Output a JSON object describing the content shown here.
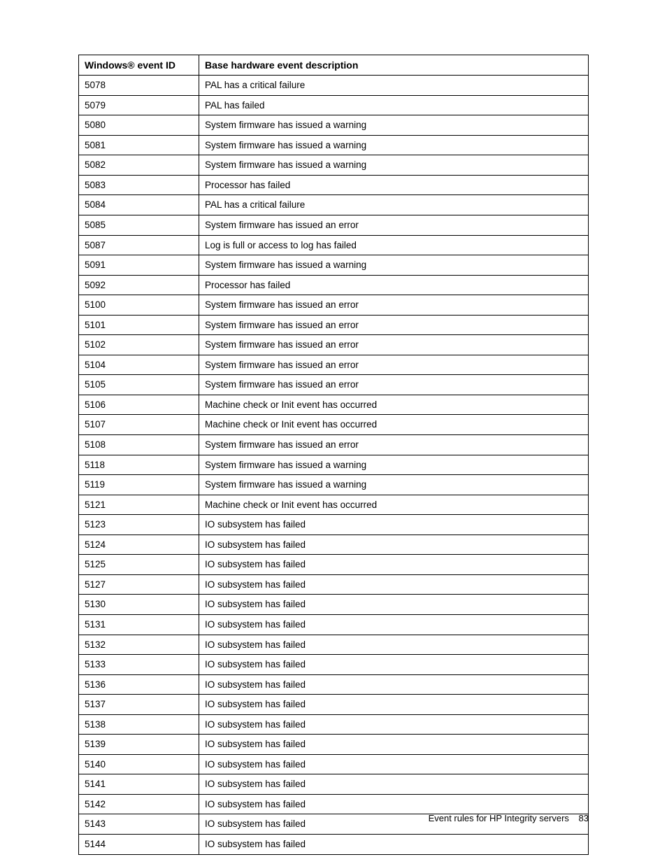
{
  "table": {
    "headers": {
      "id": "Windows® event ID",
      "desc": "Base hardware event description"
    },
    "rows": [
      {
        "id": "5078",
        "desc": "PAL has a critical failure"
      },
      {
        "id": "5079",
        "desc": "PAL has failed"
      },
      {
        "id": "5080",
        "desc": "System firmware has issued a warning"
      },
      {
        "id": "5081",
        "desc": "System firmware has issued a warning"
      },
      {
        "id": "5082",
        "desc": "System firmware has issued a warning"
      },
      {
        "id": "5083",
        "desc": "Processor has failed"
      },
      {
        "id": "5084",
        "desc": "PAL has a critical failure"
      },
      {
        "id": "5085",
        "desc": "System firmware has issued an error"
      },
      {
        "id": "5087",
        "desc": "Log is full or access to log has failed"
      },
      {
        "id": "5091",
        "desc": "System firmware has issued a warning"
      },
      {
        "id": "5092",
        "desc": "Processor has failed"
      },
      {
        "id": "5100",
        "desc": "System firmware has issued an error"
      },
      {
        "id": "5101",
        "desc": "System firmware has issued an error"
      },
      {
        "id": "5102",
        "desc": "System firmware has issued an error"
      },
      {
        "id": "5104",
        "desc": "System firmware has issued an error"
      },
      {
        "id": "5105",
        "desc": "System firmware has issued an error"
      },
      {
        "id": "5106",
        "desc": "Machine check or Init event has occurred"
      },
      {
        "id": "5107",
        "desc": "Machine check or Init event has occurred"
      },
      {
        "id": "5108",
        "desc": "System firmware has issued an error"
      },
      {
        "id": "5118",
        "desc": "System firmware has issued a warning"
      },
      {
        "id": "5119",
        "desc": "System firmware has issued a warning"
      },
      {
        "id": "5121",
        "desc": "Machine check or Init event has occurred"
      },
      {
        "id": "5123",
        "desc": "IO subsystem has failed"
      },
      {
        "id": "5124",
        "desc": "IO subsystem has failed"
      },
      {
        "id": "5125",
        "desc": "IO subsystem has failed"
      },
      {
        "id": "5127",
        "desc": "IO subsystem has failed"
      },
      {
        "id": "5130",
        "desc": "IO subsystem has failed"
      },
      {
        "id": "5131",
        "desc": "IO subsystem has failed"
      },
      {
        "id": "5132",
        "desc": "IO subsystem has failed"
      },
      {
        "id": "5133",
        "desc": "IO subsystem has failed"
      },
      {
        "id": "5136",
        "desc": "IO subsystem has failed"
      },
      {
        "id": "5137",
        "desc": "IO subsystem has failed"
      },
      {
        "id": "5138",
        "desc": "IO subsystem has failed"
      },
      {
        "id": "5139",
        "desc": "IO subsystem has failed"
      },
      {
        "id": "5140",
        "desc": "IO subsystem has failed"
      },
      {
        "id": "5141",
        "desc": "IO subsystem has failed"
      },
      {
        "id": "5142",
        "desc": "IO subsystem has failed"
      },
      {
        "id": "5143",
        "desc": "IO subsystem has failed"
      },
      {
        "id": "5144",
        "desc": "IO subsystem has failed"
      }
    ]
  },
  "footer": {
    "text": "Event rules for HP Integrity servers",
    "page": "83"
  }
}
